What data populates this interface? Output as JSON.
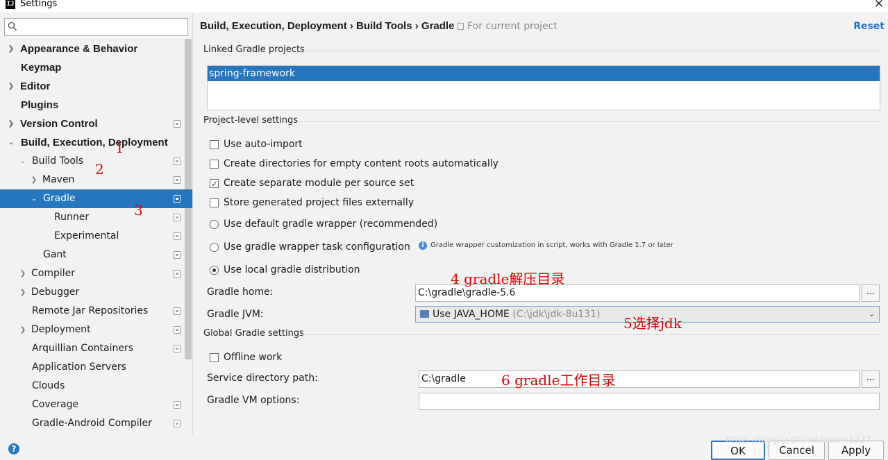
{
  "window": {
    "title": "Settings"
  },
  "sidebar": {
    "search_placeholder": "",
    "items": [
      {
        "label": "Appearance & Behavior"
      },
      {
        "label": "Keymap"
      },
      {
        "label": "Editor"
      },
      {
        "label": "Plugins"
      },
      {
        "label": "Version Control"
      },
      {
        "label": "Build, Execution, Deployment"
      },
      {
        "label": "Build Tools"
      },
      {
        "label": "Maven"
      },
      {
        "label": "Gradle"
      },
      {
        "label": "Runner"
      },
      {
        "label": "Experimental"
      },
      {
        "label": "Gant"
      },
      {
        "label": "Compiler"
      },
      {
        "label": "Debugger"
      },
      {
        "label": "Remote Jar Repositories"
      },
      {
        "label": "Deployment"
      },
      {
        "label": "Arquillian Containers"
      },
      {
        "label": "Application Servers"
      },
      {
        "label": "Clouds"
      },
      {
        "label": "Coverage"
      },
      {
        "label": "Gradle-Android Compiler"
      }
    ]
  },
  "header": {
    "breadcrumb": "Build, Execution, Deployment › Build Tools › Gradle",
    "scope": "For current project",
    "reset": "Reset"
  },
  "linked": {
    "section": "Linked Gradle projects",
    "projects": [
      "spring-framework"
    ]
  },
  "project_level": {
    "section": "Project-level settings",
    "use_auto_import": "Use auto-import",
    "create_dirs": "Create directories for empty content roots automatically",
    "separate_module": "Create separate module per source set",
    "store_external": "Store generated project files externally",
    "default_wrapper": "Use default gradle wrapper (recommended)",
    "wrapper_task": "Use gradle wrapper task configuration",
    "wrapper_hint": "Gradle wrapper customization in script, works with Gradle 1.7 or later",
    "local_dist": "Use local gradle distribution",
    "gradle_home_label": "Gradle home:",
    "gradle_home_value": "C:\\gradle\\gradle-5.6",
    "gradle_jvm_label": "Gradle JVM:",
    "gradle_jvm_value": "Use JAVA_HOME",
    "gradle_jvm_path": "(C:\\jdk\\jdk-8u131)"
  },
  "global": {
    "section": "Global Gradle settings",
    "offline": "Offline work",
    "service_dir_label": "Service directory path:",
    "service_dir_value": "C:\\gradle",
    "vm_options_label": "Gradle VM options:",
    "vm_options_value": ""
  },
  "annotations": {
    "a1": "1",
    "a2": "2",
    "a3": "3",
    "a4": "4 gradle解压目录",
    "a5": "5选择jdk",
    "a6": "6 gradle工作目录"
  },
  "footer": {
    "help": "?",
    "ok": "OK",
    "cancel": "Cancel",
    "apply": "Apply",
    "watermark": "https://blog.csdn.net/woxin1327"
  },
  "icons": {
    "search": "search-icon",
    "expand": "chevron-right-icon",
    "collapse": "chevron-down-icon",
    "project_scope": "project-settings-icon",
    "info": "info-icon",
    "jdk": "jdk-folder-icon"
  },
  "colors": {
    "accent": "#2675bf",
    "annotation": "#e00000"
  }
}
